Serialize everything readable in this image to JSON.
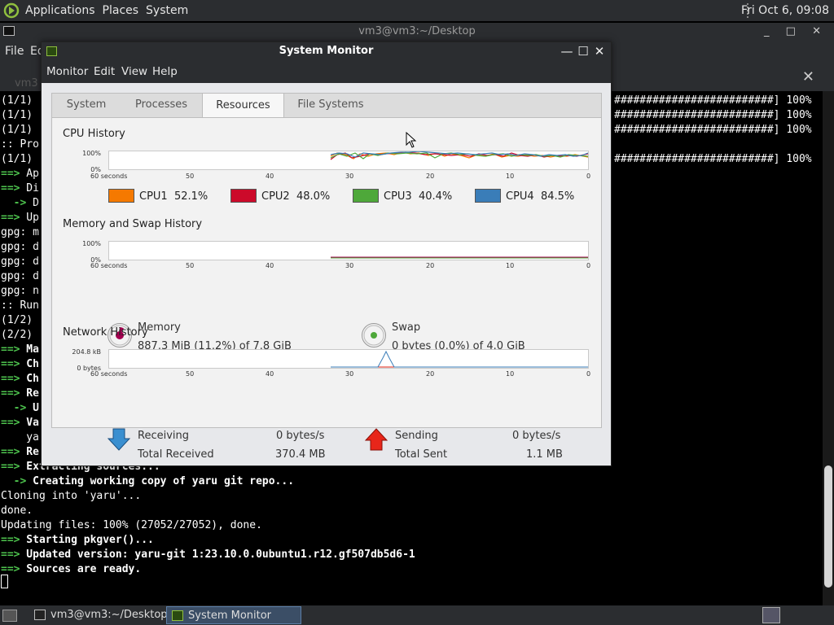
{
  "top_panel": {
    "menus": [
      "Applications",
      "Places",
      "System"
    ],
    "clock": "Fri Oct  6, 09:08"
  },
  "terminal": {
    "title": "vm3@vm3:~/Desktop",
    "window_buttons": "_ □ ✕",
    "menu": [
      "File",
      "Ed"
    ],
    "tab_label": "vm3",
    "tab_close": "✕",
    "left_lines": [
      {
        "y": 0,
        "t": "(1/1)"
      },
      {
        "y": 18,
        "t": "(1/1)"
      },
      {
        "y": 36,
        "t": "(1/1)"
      },
      {
        "y": 54,
        "t": ":: Pro"
      },
      {
        "y": 72,
        "t": "(1/1)"
      },
      {
        "y": 90,
        "a": "==>",
        "t": " Ap"
      },
      {
        "y": 108,
        "a": "==>",
        "t": " Di"
      },
      {
        "y": 126,
        "a": "  ->",
        "t": " D"
      },
      {
        "y": 144,
        "a": "==>",
        "t": " Up"
      },
      {
        "y": 162,
        "t": "gpg: m"
      },
      {
        "y": 180,
        "t": "gpg: d"
      },
      {
        "y": 198,
        "t": "gpg: d"
      },
      {
        "y": 216,
        "t": "gpg: d"
      },
      {
        "y": 234,
        "t": "gpg: n"
      },
      {
        "y": 252,
        "t": ":: Run"
      },
      {
        "y": 270,
        "t": "(1/2)"
      },
      {
        "y": 288,
        "t": "(2/2)"
      },
      {
        "y": 306,
        "a": "==>",
        "t": " Ma",
        "b": true
      },
      {
        "y": 324,
        "a": "==>",
        "t": " Ch",
        "b": true
      },
      {
        "y": 342,
        "a": "==>",
        "t": " Ch",
        "b": true
      },
      {
        "y": 360,
        "a": "==>",
        "t": " Re",
        "b": true
      },
      {
        "y": 378,
        "a": "  ->",
        "t": " U",
        "b": true
      },
      {
        "y": 396,
        "a": "==>",
        "t": " Va",
        "b": true
      },
      {
        "y": 414,
        "t": "    ya"
      },
      {
        "y": 432,
        "a": "==>",
        "t": " Re",
        "b": true
      },
      {
        "y": 450,
        "a": "==>",
        "t": " Extracting sources...",
        "b": true
      },
      {
        "y": 468,
        "a": "  ->",
        "t": " Creating working copy of yaru git repo...",
        "b": true
      },
      {
        "y": 486,
        "t": "Cloning into 'yaru'..."
      },
      {
        "y": 504,
        "t": "done."
      },
      {
        "y": 522,
        "t": "Updating files: 100% (27052/27052), done."
      },
      {
        "y": 540,
        "a": "==>",
        "t": " Starting pkgver()...",
        "b": true
      },
      {
        "y": 558,
        "a": "==>",
        "t": " Updated version: yaru-git 1:23.10.0.0ubuntu1.r12.gf507db5d6-1",
        "b": true
      },
      {
        "y": 576,
        "a": "==>",
        "t": " Sources are ready.",
        "b": true
      }
    ],
    "right_lines": [
      {
        "y": 0,
        "t": "#########################] 100%"
      },
      {
        "y": 18,
        "t": "#########################] 100%"
      },
      {
        "y": 36,
        "t": "#########################] 100%"
      },
      {
        "y": 72,
        "t": "#########################] 100%"
      }
    ]
  },
  "system_monitor": {
    "title": "System Monitor",
    "window_buttons": [
      "—",
      "☐",
      "✕"
    ],
    "menu": [
      "Monitor",
      "Edit",
      "View",
      "Help"
    ],
    "tabs": [
      "System",
      "Processes",
      "Resources",
      "File Systems"
    ],
    "x_ticks": [
      "60 seconds",
      "50",
      "40",
      "30",
      "20",
      "10",
      "0"
    ],
    "cpu": {
      "heading": "CPU History",
      "y_top": "100%",
      "y_bottom": "0%",
      "series": [
        {
          "name": "CPU1",
          "value": "52.1%",
          "color": "#f57900"
        },
        {
          "name": "CPU2",
          "value": "48.0%",
          "color": "#cc0a2a"
        },
        {
          "name": "CPU3",
          "value": "40.4%",
          "color": "#4ea83a"
        },
        {
          "name": "CPU4",
          "value": "84.5%",
          "color": "#3a7db8"
        }
      ]
    },
    "memory": {
      "heading": "Memory and Swap History",
      "y_top": "100%",
      "y_bottom": "0%",
      "mem_label": "Memory",
      "mem_value": "887.3 MiB (11.2%) of 7.8 GiB",
      "mem_color": "#a40050",
      "swap_label": "Swap",
      "swap_value": "0 bytes (0.0%) of 4.0 GiB",
      "swap_color": "#4ea83a"
    },
    "network": {
      "heading": "Network History",
      "y_top": "204.8 kB",
      "y_bottom": "0 bytes",
      "recv_label": "Receiving",
      "recv_value": "0 bytes/s",
      "total_recv_label": "Total Received",
      "total_recv_value": "370.4 MB",
      "send_label": "Sending",
      "send_value": "0 bytes/s",
      "total_sent_label": "Total Sent",
      "total_sent_value": "1.1 MB",
      "recv_color": "#3a7db8",
      "send_color": "#e02010"
    }
  },
  "taskbar": {
    "items": [
      "vm3@vm3:~/Desktop",
      "System Monitor"
    ]
  }
}
